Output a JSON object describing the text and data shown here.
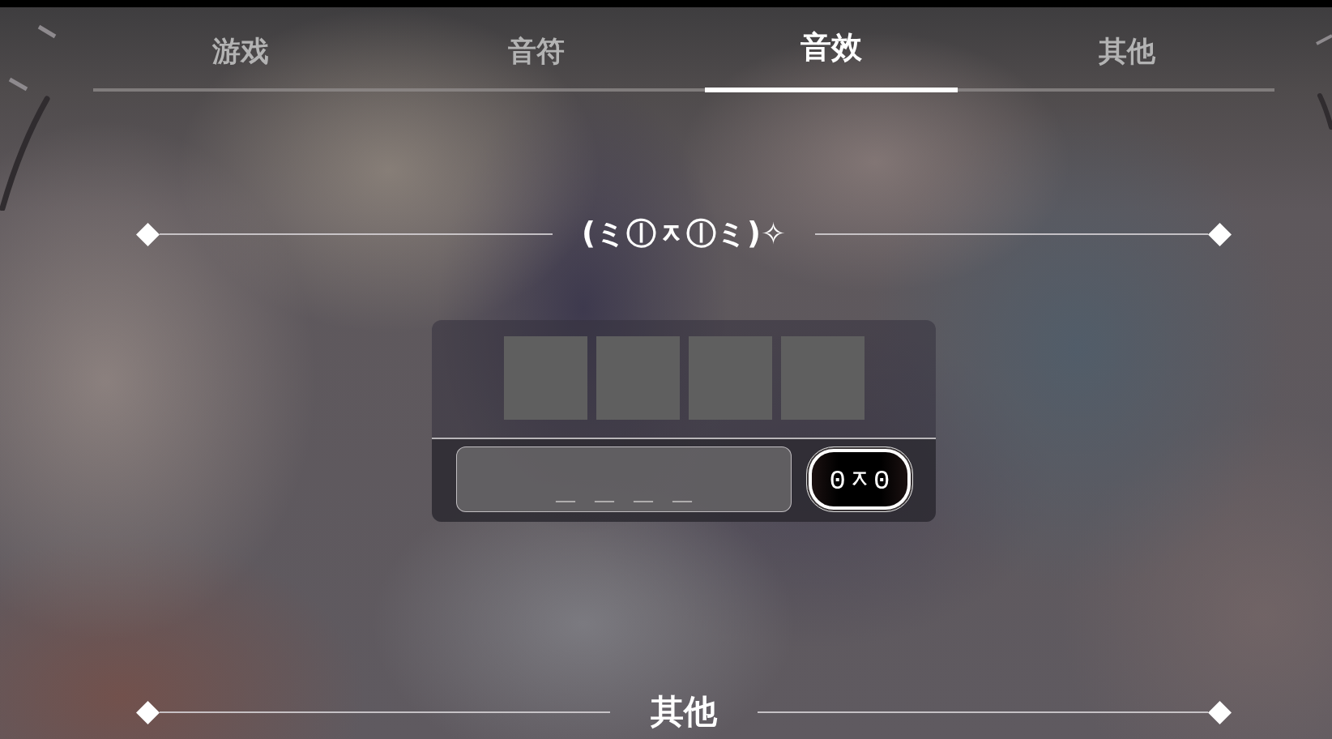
{
  "tabs": [
    {
      "label": "游戏",
      "selected": false
    },
    {
      "label": "音符",
      "selected": false
    },
    {
      "label": "音效",
      "selected": true
    },
    {
      "label": "其他",
      "selected": false
    }
  ],
  "sections": [
    {
      "title": "(ミⓛᆽⓛミ)✧",
      "panel": {
        "slots": [
          {
            "kind": "empty"
          },
          {
            "kind": "empty"
          },
          {
            "kind": "empty"
          },
          {
            "kind": "empty"
          }
        ],
        "input": {
          "placeholder": "_ _ _ _"
        },
        "button": {
          "label": "0ᆽ0"
        }
      }
    },
    {
      "title": "其他"
    }
  ]
}
